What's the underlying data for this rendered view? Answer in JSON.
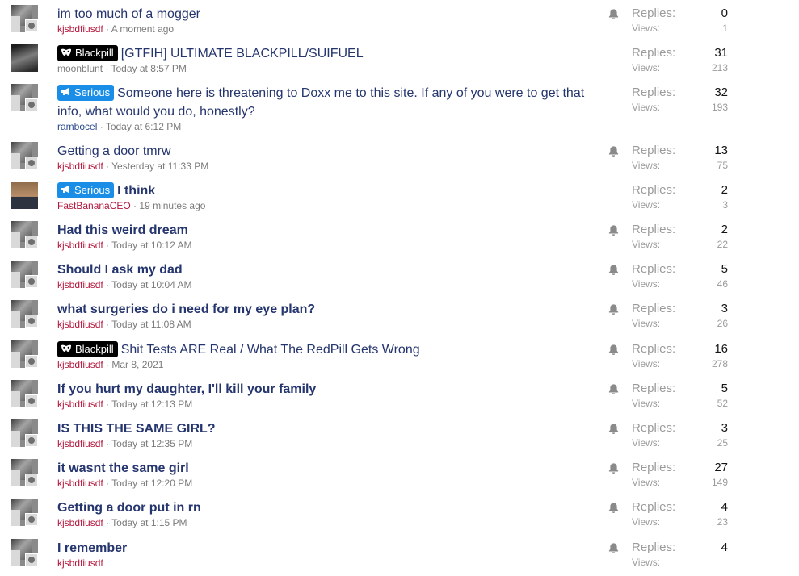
{
  "thread_list": {
    "replies_label": "Replies:",
    "views_label": "Views:",
    "threads": [
      {
        "title": "im too much of a mogger",
        "prefix": "",
        "prefix_color": "",
        "bold": false,
        "author": "kjsbdfiusdf",
        "time": "A moment ago",
        "replies": "0",
        "views": "1",
        "watched": true,
        "avatar": "default"
      },
      {
        "title": "[GTFIH] ULTIMATE BLACKPILL/SUIFUEL",
        "prefix": "Blackpill",
        "prefix_color": "#000000",
        "bold": false,
        "author": "moonblunt",
        "time": "Today at 8:57 PM",
        "replies": "31",
        "views": "213",
        "watched": false,
        "avatar": "alt"
      },
      {
        "title": "Someone here is threatening to Doxx me to this site. If any of you were to get that info, what would you do, honestly?",
        "prefix": "Serious",
        "prefix_color": "#1a8ee6",
        "bold": false,
        "author": "rambocel",
        "time": "Today at 6:12 PM",
        "replies": "32",
        "views": "193",
        "watched": false,
        "avatar": "default"
      },
      {
        "title": "Getting a door tmrw",
        "prefix": "",
        "prefix_color": "",
        "bold": false,
        "author": "kjsbdfiusdf",
        "time": "Yesterday at 11:33 PM",
        "replies": "13",
        "views": "75",
        "watched": true,
        "avatar": "default"
      },
      {
        "title": "I think",
        "prefix": "Serious",
        "prefix_color": "#1a8ee6",
        "bold": true,
        "author": "FastBananaCEO",
        "time": "19 minutes ago",
        "replies": "2",
        "views": "3",
        "watched": false,
        "avatar": "face"
      },
      {
        "title": "Had this weird dream",
        "prefix": "",
        "prefix_color": "",
        "bold": true,
        "author": "kjsbdfiusdf",
        "time": "Today at 10:12 AM",
        "replies": "2",
        "views": "22",
        "watched": true,
        "avatar": "default"
      },
      {
        "title": "Should I ask my dad",
        "prefix": "",
        "prefix_color": "",
        "bold": true,
        "author": "kjsbdfiusdf",
        "time": "Today at 10:04 AM",
        "replies": "5",
        "views": "46",
        "watched": true,
        "avatar": "default"
      },
      {
        "title": "what surgeries do i need for my eye plan?",
        "prefix": "",
        "prefix_color": "",
        "bold": true,
        "author": "kjsbdfiusdf",
        "time": "Today at 11:08 AM",
        "replies": "3",
        "views": "26",
        "watched": true,
        "avatar": "default"
      },
      {
        "title": "Shit Tests ARE Real / What The RedPill Gets Wrong",
        "prefix": "Blackpill",
        "prefix_color": "#000000",
        "bold": false,
        "author": "kjsbdfiusdf",
        "time": "Mar 8, 2021",
        "replies": "16",
        "views": "278",
        "watched": true,
        "avatar": "default"
      },
      {
        "title": "If you hurt my daughter, I'll kill your family",
        "prefix": "",
        "prefix_color": "",
        "bold": true,
        "author": "kjsbdfiusdf",
        "time": "Today at 12:13 PM",
        "replies": "5",
        "views": "52",
        "watched": true,
        "avatar": "default"
      },
      {
        "title": "IS THIS THE SAME GIRL?",
        "prefix": "",
        "prefix_color": "",
        "bold": true,
        "author": "kjsbdfiusdf",
        "time": "Today at 12:35 PM",
        "replies": "3",
        "views": "25",
        "watched": true,
        "avatar": "default"
      },
      {
        "title": "it wasnt the same girl",
        "prefix": "",
        "prefix_color": "",
        "bold": true,
        "author": "kjsbdfiusdf",
        "time": "Today at 12:20 PM",
        "replies": "27",
        "views": "149",
        "watched": true,
        "avatar": "default"
      },
      {
        "title": "Getting a door put in rn",
        "prefix": "",
        "prefix_color": "",
        "bold": true,
        "author": "kjsbdfiusdf",
        "time": "Today at 1:15 PM",
        "replies": "4",
        "views": "23",
        "watched": true,
        "avatar": "default"
      },
      {
        "title": "I remember",
        "prefix": "",
        "prefix_color": "",
        "bold": true,
        "author": "kjsbdfiusdf",
        "time": "",
        "replies": "4",
        "views": "",
        "watched": true,
        "avatar": "default"
      }
    ]
  }
}
